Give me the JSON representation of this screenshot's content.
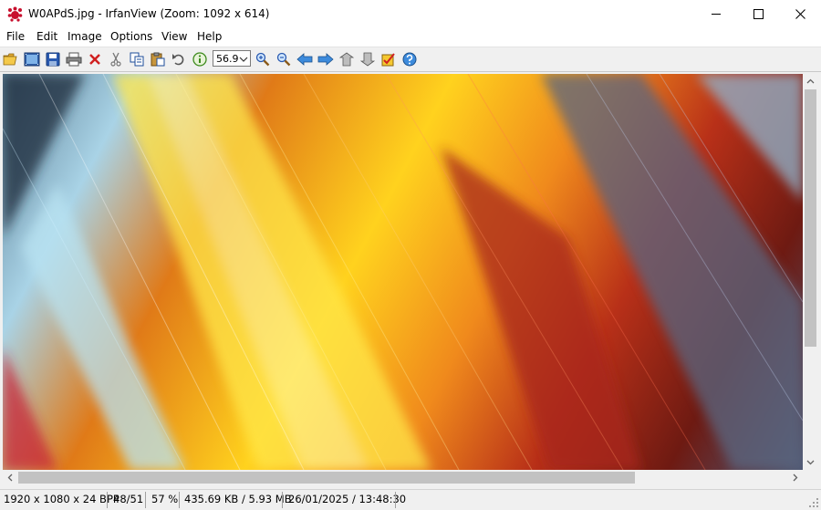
{
  "window": {
    "title": "W0APdS.jpg - IrfanView (Zoom: 1092 x 614)",
    "app_icon": "irfanview-paw-icon",
    "controls": [
      "minimize-icon",
      "maximize-icon",
      "close-icon"
    ]
  },
  "menu": {
    "file": "File",
    "edit": "Edit",
    "image": "Image",
    "options": "Options",
    "view": "View",
    "help": "Help"
  },
  "toolbar": {
    "icons": [
      "open-folder-icon",
      "slideshow-icon",
      "save-icon",
      "print-icon",
      "delete-icon",
      "cut-icon",
      "copy-icon",
      "paste-icon",
      "undo-icon",
      "info-icon",
      "zoom-in-icon",
      "zoom-out-icon",
      "previous-icon",
      "next-icon",
      "first-file-icon",
      "last-file-icon",
      "properties-icon",
      "help-icon"
    ],
    "zoom_value": "56.9"
  },
  "image": {
    "description": "abstract fractal flame artwork, diagonal fibrous streaks in blue, orange, yellow and red",
    "colors": {
      "blue": "#7ea8c4",
      "orange": "#f08a1c",
      "yellow": "#ffd21e",
      "red": "#a8281a",
      "slate": "#5d6b88"
    }
  },
  "status": {
    "dimensions": "1920 x 1080 x 24 BPP",
    "index": "48/51",
    "zoom": "57 %",
    "size": "435.69 KB / 5.93 MB",
    "datetime": "26/01/2025 / 13:48:30"
  },
  "colors": {
    "chrome": "#f0f0f0",
    "scroll_thumb": "#c2c2c2",
    "close_red": "#c42b1c"
  }
}
